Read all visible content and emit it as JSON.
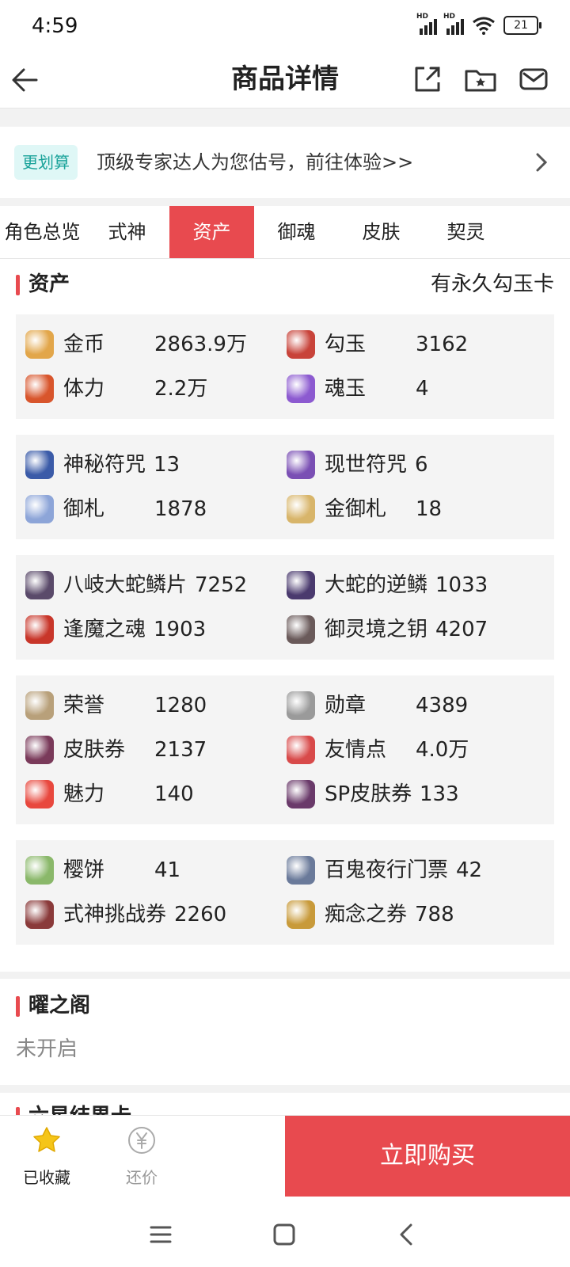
{
  "status": {
    "time": "4:59",
    "signal_hd": "HD",
    "battery": "21"
  },
  "header": {
    "title": "商品详情"
  },
  "promo": {
    "badge": "更划算",
    "text": "顶级专家达人为您估号，前往体验>>"
  },
  "tabs": [
    "角色总览",
    "式神",
    "资产",
    "御魂",
    "皮肤",
    "契灵"
  ],
  "assets": {
    "title": "资产",
    "right_note": "有永久勾玉卡",
    "groups": [
      [
        [
          {
            "label": "金币",
            "value": "2863.9万",
            "color": "#e2a64a",
            "fixed": true
          },
          {
            "label": "勾玉",
            "value": "3162",
            "color": "#c8433a",
            "fixed": true
          }
        ],
        [
          {
            "label": "体力",
            "value": "2.2万",
            "color": "#d8552c",
            "fixed": true
          },
          {
            "label": "魂玉",
            "value": "4",
            "color": "#8c5ad0",
            "fixed": true
          }
        ]
      ],
      [
        [
          {
            "label": "神秘符咒",
            "value": "13",
            "color": "#3b5ba8",
            "fixed": false
          },
          {
            "label": "现世符咒",
            "value": "6",
            "color": "#7a4fb4",
            "fixed": false
          }
        ],
        [
          {
            "label": "御札",
            "value": "1878",
            "color": "#8da5d8",
            "fixed": true
          },
          {
            "label": "金御札",
            "value": "18",
            "color": "#d8b56a",
            "fixed": true
          }
        ]
      ],
      [
        [
          {
            "label": "八岐大蛇鳞片",
            "value": "7252",
            "color": "#5a4a6a",
            "fixed": false
          },
          {
            "label": "大蛇的逆鳞",
            "value": "1033",
            "color": "#4a3a6e",
            "fixed": false
          }
        ],
        [
          {
            "label": "逢魔之魂",
            "value": "1903",
            "color": "#c8362a",
            "fixed": false
          },
          {
            "label": "御灵境之钥",
            "value": "4207",
            "color": "#6a5a5a",
            "fixed": false
          }
        ]
      ],
      [
        [
          {
            "label": "荣誉",
            "value": "1280",
            "color": "#b8a07a",
            "fixed": true
          },
          {
            "label": "勋章",
            "value": "4389",
            "color": "#9a9a9a",
            "fixed": true
          }
        ],
        [
          {
            "label": "皮肤券",
            "value": "2137",
            "color": "#7a3a5a",
            "fixed": true
          },
          {
            "label": "友情点",
            "value": "4.0万",
            "color": "#d84a4a",
            "fixed": true
          }
        ],
        [
          {
            "label": "魅力",
            "value": "140",
            "color": "#e8483e",
            "fixed": true
          },
          {
            "label": "SP皮肤券",
            "value": "133",
            "color": "#6a3a6a",
            "fixed": false
          }
        ]
      ],
      [
        [
          {
            "label": "樱饼",
            "value": "41",
            "color": "#8ab86a",
            "fixed": true
          },
          {
            "label": "百鬼夜行门票",
            "value": "42",
            "color": "#6a7a9a",
            "fixed": false
          }
        ],
        [
          {
            "label": "式神挑战券",
            "value": "2260",
            "color": "#8a3a3a",
            "fixed": false
          },
          {
            "label": "痴念之券",
            "value": "788",
            "color": "#c89a3a",
            "fixed": false
          }
        ]
      ]
    ]
  },
  "yaozhige": {
    "title": "曜之阁",
    "status": "未开启"
  },
  "next_section_partial": {
    "title": "六星结界卡"
  },
  "bottom": {
    "favorite_label": "已收藏",
    "bargain_label": "还价",
    "buy_label": "立即购买"
  },
  "colors": {
    "accent": "#e84a4f",
    "teal": "#1aa39a",
    "star": "#f5c518"
  }
}
